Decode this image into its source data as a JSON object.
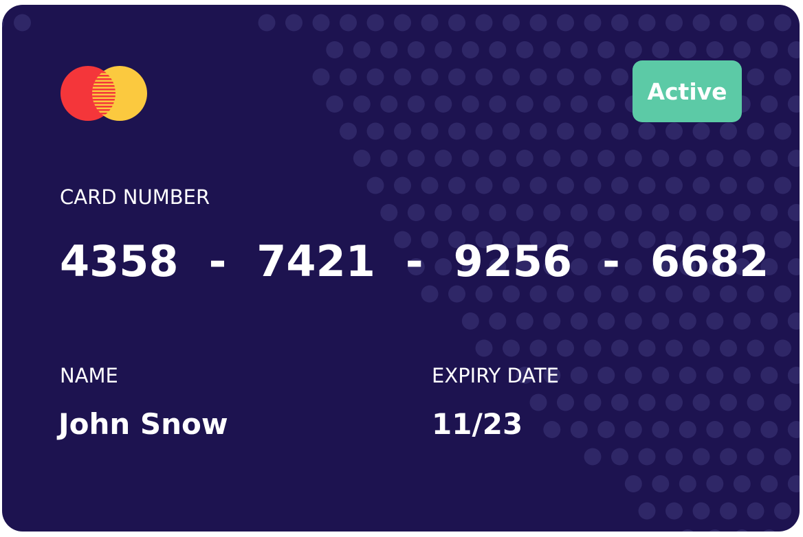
{
  "card": {
    "brand_icon": "mastercard-logo-icon",
    "status": "Active",
    "number_label": "CARD NUMBER",
    "number_groups": [
      "4358",
      "7421",
      "9256",
      "6682"
    ],
    "separator": "-",
    "name_label": "NAME",
    "name_value": "John Snow",
    "expiry_label": "EXPIRY DATE",
    "expiry_value": "11/23"
  },
  "colors": {
    "card_background": "#1d1350",
    "dot_pattern": "#2f2767",
    "status_badge": "#5ccaa6",
    "logo_red": "#f4363a",
    "logo_yellow": "#fbc93f",
    "text": "#ffffff"
  }
}
